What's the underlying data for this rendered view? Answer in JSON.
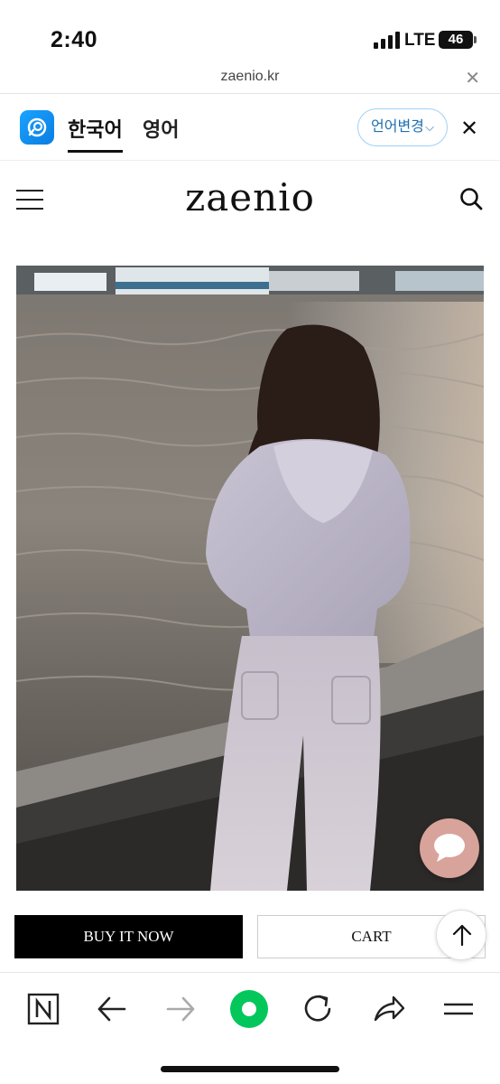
{
  "status_bar": {
    "time": "2:40",
    "network": "LTE",
    "battery": "46"
  },
  "url_bar": {
    "domain": "zaenio.kr",
    "close_icon": "close-icon"
  },
  "translate_bar": {
    "app_icon": "papago-icon",
    "lang_selected": "한국어",
    "lang_other": "영어",
    "change_label": "언어변경",
    "change_icon": "chevron-down-icon",
    "close_icon": "close-icon"
  },
  "site_header": {
    "brand": "zaenio",
    "menu_icon": "hamburger-icon",
    "search_icon": "search-icon"
  },
  "product": {
    "image": "product-photo",
    "chat_icon": "chat-bubble-icon"
  },
  "actions": {
    "buy_label": "BUY IT NOW",
    "cart_label": "CART",
    "top_icon": "arrow-up-icon"
  },
  "browser_toolbar": {
    "items": [
      "naver-icon",
      "back-arrow-icon",
      "forward-arrow-icon",
      "green-home-icon",
      "refresh-icon",
      "share-icon",
      "menu-icon"
    ],
    "accent": "#03c75a"
  },
  "colors": {
    "buy_bg": "#000000",
    "chat_bg": "#d8a39a",
    "lang_change_border": "#9fd1f5"
  }
}
